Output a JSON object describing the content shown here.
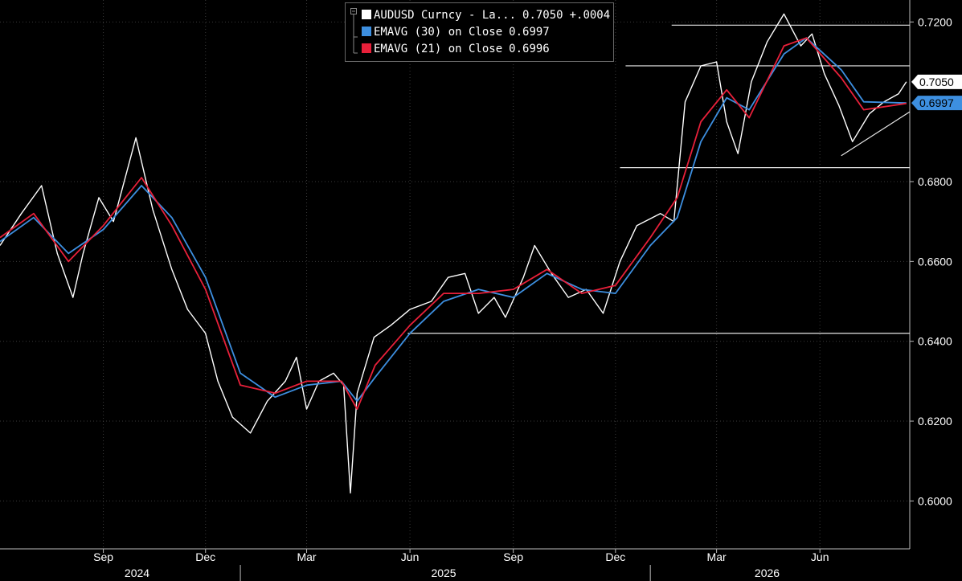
{
  "legend": {
    "items": [
      {
        "name": "AUDUSD Curncy - La...",
        "value": "0.7050",
        "change": "+.0004",
        "color": "#ffffff"
      },
      {
        "name": "EMAVG (30)  on Close",
        "value": "0.6997",
        "color": "#3d8fe0"
      },
      {
        "name": "EMAVG (21)  on Close",
        "value": "0.6996",
        "color": "#e8203a"
      }
    ]
  },
  "chart_data": {
    "type": "line",
    "title": "",
    "x_range": [
      "2024-06-01",
      "2026-08-20"
    ],
    "ylim": [
      0.588,
      0.7255
    ],
    "y_ticks": [
      0.72,
      0.68,
      0.66,
      0.64,
      0.62,
      0.6
    ],
    "y_tick_labels": [
      "0.7200",
      "0.6800",
      "0.6600",
      "0.6400",
      "0.6200",
      "0.6000"
    ],
    "x_ticks": [
      {
        "date": "2024-09-01",
        "label": "Sep"
      },
      {
        "date": "2024-12-01",
        "label": "Dec"
      },
      {
        "date": "2025-03-01",
        "label": "Mar"
      },
      {
        "date": "2025-06-01",
        "label": "Jun"
      },
      {
        "date": "2025-09-01",
        "label": "Sep"
      },
      {
        "date": "2025-12-01",
        "label": "Dec"
      },
      {
        "date": "2026-03-01",
        "label": "Mar"
      },
      {
        "date": "2026-06-01",
        "label": "Jun"
      }
    ],
    "x_years": [
      {
        "date": "2024-10-01",
        "label": "2024"
      },
      {
        "date": "2025-07-01",
        "label": "2025"
      },
      {
        "date": "2026-04-15",
        "label": "2026"
      }
    ],
    "year_dividers": [
      "2025-01-01",
      "2026-01-01"
    ],
    "price_labels": [
      {
        "value": 0.705,
        "label": "0.7050",
        "bg": "#ffffff",
        "fg": "#000000"
      },
      {
        "value": 0.6997,
        "label": "0.6997",
        "bg": "#3d8fe0",
        "fg": "#000000"
      }
    ],
    "series": [
      {
        "name": "AUDUSD Curncy - La...",
        "color": "#ffffff",
        "points": [
          [
            "2024-06-01",
            0.664
          ],
          [
            "2024-06-20",
            0.672
          ],
          [
            "2024-07-08",
            0.679
          ],
          [
            "2024-07-22",
            0.662
          ],
          [
            "2024-08-05",
            0.651
          ],
          [
            "2024-08-14",
            0.662
          ],
          [
            "2024-08-28",
            0.676
          ],
          [
            "2024-09-10",
            0.67
          ],
          [
            "2024-09-30",
            0.691
          ],
          [
            "2024-10-15",
            0.673
          ],
          [
            "2024-11-01",
            0.658
          ],
          [
            "2024-11-15",
            0.648
          ],
          [
            "2024-12-01",
            0.642
          ],
          [
            "2024-12-12",
            0.63
          ],
          [
            "2024-12-25",
            0.621
          ],
          [
            "2025-01-10",
            0.617
          ],
          [
            "2025-01-25",
            0.625
          ],
          [
            "2025-02-10",
            0.63
          ],
          [
            "2025-02-20",
            0.636
          ],
          [
            "2025-03-01",
            0.623
          ],
          [
            "2025-03-12",
            0.63
          ],
          [
            "2025-03-25",
            0.632
          ],
          [
            "2025-04-03",
            0.629
          ],
          [
            "2025-04-09",
            0.602
          ],
          [
            "2025-04-15",
            0.627
          ],
          [
            "2025-04-30",
            0.641
          ],
          [
            "2025-05-15",
            0.644
          ],
          [
            "2025-06-01",
            0.648
          ],
          [
            "2025-06-20",
            0.65
          ],
          [
            "2025-07-05",
            0.656
          ],
          [
            "2025-07-20",
            0.657
          ],
          [
            "2025-08-01",
            0.647
          ],
          [
            "2025-08-15",
            0.651
          ],
          [
            "2025-08-25",
            0.646
          ],
          [
            "2025-09-10",
            0.656
          ],
          [
            "2025-09-20",
            0.664
          ],
          [
            "2025-10-05",
            0.657
          ],
          [
            "2025-10-20",
            0.651
          ],
          [
            "2025-11-05",
            0.653
          ],
          [
            "2025-11-20",
            0.647
          ],
          [
            "2025-12-05",
            0.66
          ],
          [
            "2025-12-20",
            0.669
          ],
          [
            "2026-01-10",
            0.672
          ],
          [
            "2026-01-22",
            0.67
          ],
          [
            "2026-02-01",
            0.7
          ],
          [
            "2026-02-15",
            0.709
          ],
          [
            "2026-03-01",
            0.71
          ],
          [
            "2026-03-10",
            0.695
          ],
          [
            "2026-03-20",
            0.687
          ],
          [
            "2026-04-01",
            0.705
          ],
          [
            "2026-04-15",
            0.715
          ],
          [
            "2026-04-30",
            0.722
          ],
          [
            "2026-05-15",
            0.714
          ],
          [
            "2026-05-25",
            0.717
          ],
          [
            "2026-06-05",
            0.707
          ],
          [
            "2026-06-18",
            0.699
          ],
          [
            "2026-06-30",
            0.69
          ],
          [
            "2026-07-15",
            0.697
          ],
          [
            "2026-07-28",
            0.7
          ],
          [
            "2026-08-10",
            0.702
          ],
          [
            "2026-08-17",
            0.705
          ]
        ]
      },
      {
        "name": "EMAVG (30)  on Close",
        "color": "#3d8fe0",
        "points": [
          [
            "2024-06-01",
            0.665
          ],
          [
            "2024-07-01",
            0.671
          ],
          [
            "2024-08-01",
            0.662
          ],
          [
            "2024-09-01",
            0.668
          ],
          [
            "2024-10-05",
            0.679
          ],
          [
            "2024-11-01",
            0.671
          ],
          [
            "2024-12-01",
            0.656
          ],
          [
            "2025-01-01",
            0.632
          ],
          [
            "2025-02-01",
            0.626
          ],
          [
            "2025-03-01",
            0.629
          ],
          [
            "2025-04-01",
            0.63
          ],
          [
            "2025-04-15",
            0.625
          ],
          [
            "2025-05-01",
            0.631
          ],
          [
            "2025-06-01",
            0.642
          ],
          [
            "2025-07-01",
            0.65
          ],
          [
            "2025-08-01",
            0.653
          ],
          [
            "2025-09-01",
            0.651
          ],
          [
            "2025-10-01",
            0.657
          ],
          [
            "2025-11-01",
            0.653
          ],
          [
            "2025-12-01",
            0.652
          ],
          [
            "2026-01-01",
            0.664
          ],
          [
            "2026-01-25",
            0.671
          ],
          [
            "2026-02-15",
            0.69
          ],
          [
            "2026-03-10",
            0.701
          ],
          [
            "2026-03-30",
            0.698
          ],
          [
            "2026-04-30",
            0.712
          ],
          [
            "2026-05-20",
            0.716
          ],
          [
            "2026-06-20",
            0.708
          ],
          [
            "2026-07-10",
            0.7
          ],
          [
            "2026-08-17",
            0.6997
          ]
        ]
      },
      {
        "name": "EMAVG (21)  on Close",
        "color": "#e8203a",
        "points": [
          [
            "2024-06-01",
            0.666
          ],
          [
            "2024-07-01",
            0.672
          ],
          [
            "2024-08-01",
            0.66
          ],
          [
            "2024-09-01",
            0.669
          ],
          [
            "2024-10-05",
            0.681
          ],
          [
            "2024-11-01",
            0.669
          ],
          [
            "2024-12-01",
            0.653
          ],
          [
            "2025-01-01",
            0.629
          ],
          [
            "2025-02-01",
            0.627
          ],
          [
            "2025-03-01",
            0.63
          ],
          [
            "2025-04-01",
            0.63
          ],
          [
            "2025-04-15",
            0.623
          ],
          [
            "2025-05-01",
            0.634
          ],
          [
            "2025-06-01",
            0.644
          ],
          [
            "2025-07-01",
            0.652
          ],
          [
            "2025-08-01",
            0.652
          ],
          [
            "2025-09-01",
            0.653
          ],
          [
            "2025-10-01",
            0.658
          ],
          [
            "2025-11-01",
            0.652
          ],
          [
            "2025-12-01",
            0.654
          ],
          [
            "2026-01-01",
            0.666
          ],
          [
            "2026-01-25",
            0.676
          ],
          [
            "2026-02-15",
            0.695
          ],
          [
            "2026-03-10",
            0.703
          ],
          [
            "2026-03-30",
            0.696
          ],
          [
            "2026-04-30",
            0.714
          ],
          [
            "2026-05-20",
            0.716
          ],
          [
            "2026-06-20",
            0.706
          ],
          [
            "2026-07-10",
            0.698
          ],
          [
            "2026-08-17",
            0.6996
          ]
        ]
      }
    ],
    "annotations": [
      {
        "type": "hline",
        "value": 0.7192,
        "from": "2026-01-20",
        "to": "2026-08-20"
      },
      {
        "type": "hline",
        "value": 0.709,
        "from": "2025-12-10",
        "to": "2026-08-20"
      },
      {
        "type": "hline",
        "value": 0.6835,
        "from": "2025-12-05",
        "to": "2026-08-20"
      },
      {
        "type": "hline",
        "value": 0.642,
        "from": "2025-05-30",
        "to": "2026-08-20"
      },
      {
        "type": "trendline",
        "from": [
          "2026-06-20",
          0.6865
        ],
        "to": [
          "2026-08-20",
          0.6975
        ]
      }
    ]
  }
}
